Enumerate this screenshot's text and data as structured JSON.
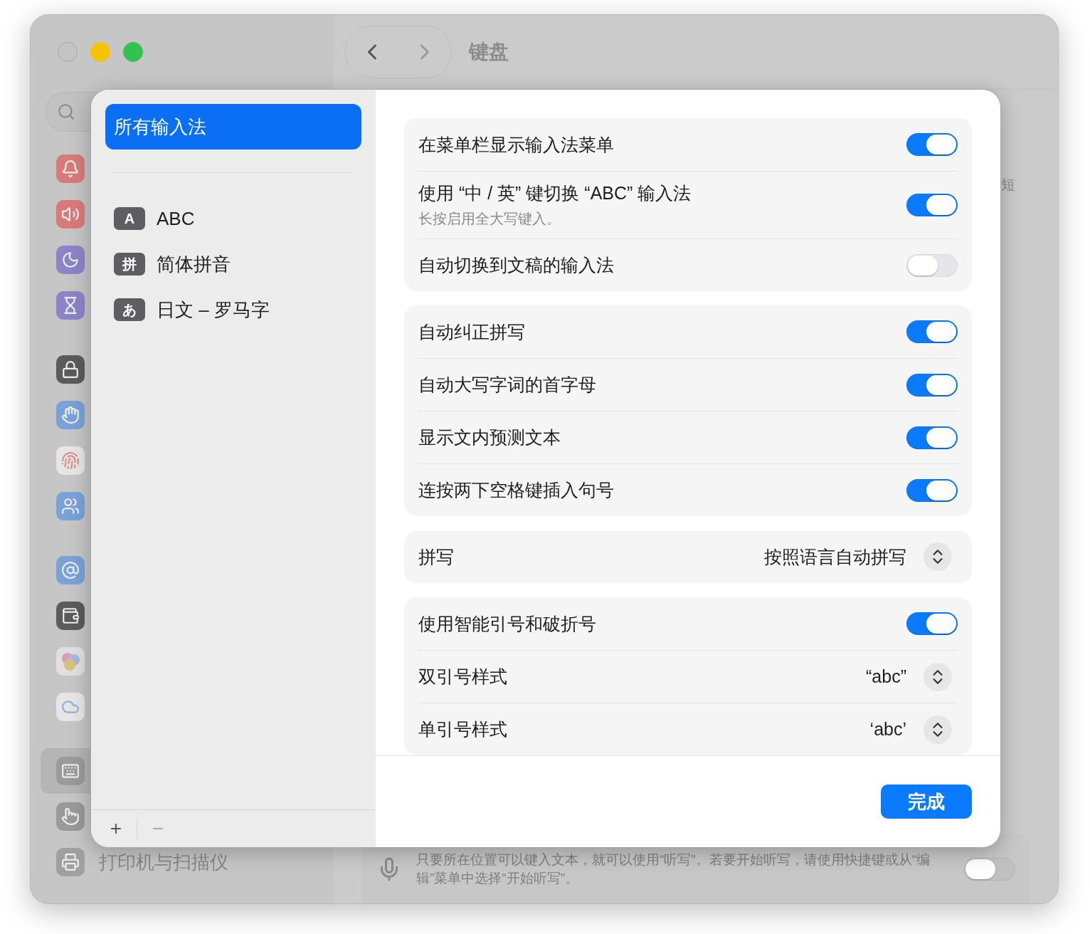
{
  "background_window": {
    "title": "键盘",
    "sidebar_items": [
      {
        "selected": false
      },
      {
        "selected": false
      },
      {
        "selected": false
      },
      {
        "selected": false
      },
      {
        "selected": false
      },
      {
        "selected": false
      },
      {
        "selected": false
      },
      {
        "selected": false
      },
      {
        "selected": false
      },
      {
        "selected": false
      },
      {
        "selected": false
      },
      {
        "selected": false
      },
      {
        "selected": true
      },
      {
        "selected": false
      },
      {
        "label": "打印机与扫描仪",
        "selected": false
      }
    ],
    "side_fragment": "短",
    "dictation": {
      "note": "只要所在位置可以键入文本，就可以使用“听写”。若要开始听写，请使用快捷键或从“编辑”菜单中选择“开始听写”。",
      "on": false
    }
  },
  "sheet": {
    "sidebar": {
      "items": [
        {
          "label": "所有输入法",
          "selected": true
        }
      ],
      "input_sources": [
        {
          "badge": "A",
          "label": "ABC"
        },
        {
          "badge": "拼",
          "label": "简体拼音"
        },
        {
          "badge": "あ",
          "label": "日文 – 罗马字"
        }
      ],
      "add": "+",
      "remove": "−"
    },
    "groups": [
      [
        {
          "kind": "toggle",
          "label": "在菜单栏显示输入法菜单",
          "on": true
        },
        {
          "kind": "toggle",
          "label": "使用 “中 / 英” 键切换 “ABC” 输入法",
          "note": "长按启用全大写键入。",
          "on": true
        },
        {
          "kind": "toggle",
          "label": "自动切换到文稿的输入法",
          "on": false
        }
      ],
      [
        {
          "kind": "toggle",
          "label": "自动纠正拼写",
          "on": true
        },
        {
          "kind": "toggle",
          "label": "自动大写字词的首字母",
          "on": true
        },
        {
          "kind": "toggle",
          "label": "显示文内预测文本",
          "on": true
        },
        {
          "kind": "toggle",
          "label": "连按两下空格键插入句号",
          "on": true
        }
      ],
      [
        {
          "kind": "popup",
          "label": "拼写",
          "value": "按照语言自动拼写"
        }
      ],
      [
        {
          "kind": "toggle",
          "label": "使用智能引号和破折号",
          "on": true
        },
        {
          "kind": "popup",
          "label": "双引号样式",
          "value": "“abc”"
        },
        {
          "kind": "popup",
          "label": "单引号样式",
          "value": "‘abc’"
        }
      ]
    ],
    "done": "完成"
  }
}
